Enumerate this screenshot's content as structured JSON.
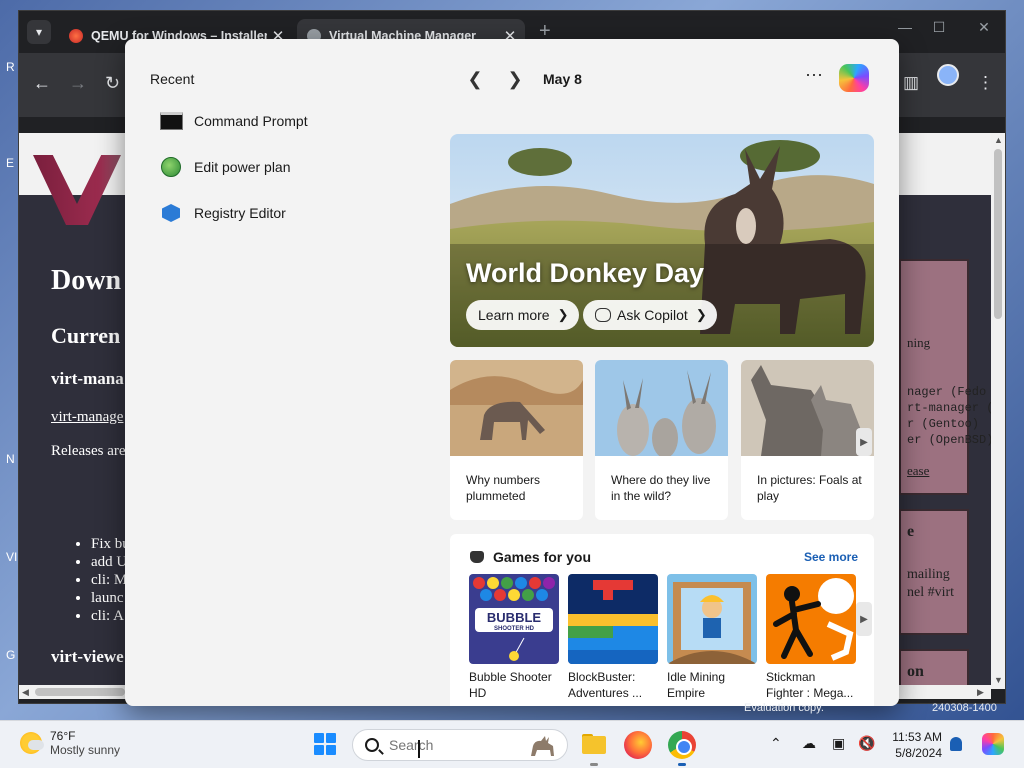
{
  "browser": {
    "tabs": [
      {
        "title": "QEMU for Windows – Installers",
        "close": "✕"
      },
      {
        "title": "Virtual Machine Manager",
        "close": "✕"
      }
    ],
    "new_tab": "+",
    "window_controls": {
      "minimize": "—",
      "maximize": "☐",
      "close": "✕"
    },
    "nav": {
      "back": "←",
      "forward": "→",
      "reload": "↻",
      "menu": "⋮",
      "sidebar": "▥"
    }
  },
  "webpage": {
    "h1": "Down",
    "h2": "Curren",
    "h3": "virt-mana",
    "link": "virt-manage",
    "p": "Releases are",
    "list": [
      "Fix bu",
      "add U",
      "cli: M",
      "launc",
      "cli: A"
    ],
    "h3b": "virt-viewe",
    "side": {
      "box1": [
        "ning",
        "nager (Fedo",
        "rt-manager (D",
        "r (Gentoo)",
        "er (OpenBSD)",
        "ease"
      ],
      "box2_title": "e",
      "box2": [
        "mailing",
        "nel #virt"
      ],
      "box3_title": "on"
    }
  },
  "panel": {
    "recent_title": "Recent",
    "recent": [
      {
        "label": "Command Prompt",
        "icon": "command-prompt-icon"
      },
      {
        "label": "Edit power plan",
        "icon": "power-plan-icon"
      },
      {
        "label": "Registry Editor",
        "icon": "registry-editor-icon"
      }
    ],
    "date": "May 8",
    "more": "⋯",
    "hero": {
      "title": "World Donkey Day",
      "learn_more": "Learn more",
      "ask_copilot": "Ask Copilot"
    },
    "cards": [
      {
        "text": "Why numbers plummeted"
      },
      {
        "text": "Where do they live in the wild?"
      },
      {
        "text": "In pictures: Foals at play"
      }
    ],
    "games": {
      "title": "Games for you",
      "see_more": "See more",
      "items": [
        {
          "name": "Bubble Shooter HD"
        },
        {
          "name": "BlockBuster: Adventures ..."
        },
        {
          "name": "Idle Mining Empire"
        },
        {
          "name": "Stickman Fighter : Mega..."
        }
      ],
      "bubble_logo_line1": "BUBBLE",
      "bubble_logo_line2": "SHOOTER HD"
    }
  },
  "taskbar": {
    "weather": {
      "temp": "76°F",
      "condition": "Mostly sunny"
    },
    "search_placeholder": "Search",
    "clock": {
      "time": "11:53 AM",
      "date": "5/8/2024"
    },
    "watermark": "Evaluation copy.",
    "watermark_build": "240308-1400"
  },
  "desktop_letters": [
    "R",
    "E",
    "N",
    "VI",
    "G"
  ]
}
